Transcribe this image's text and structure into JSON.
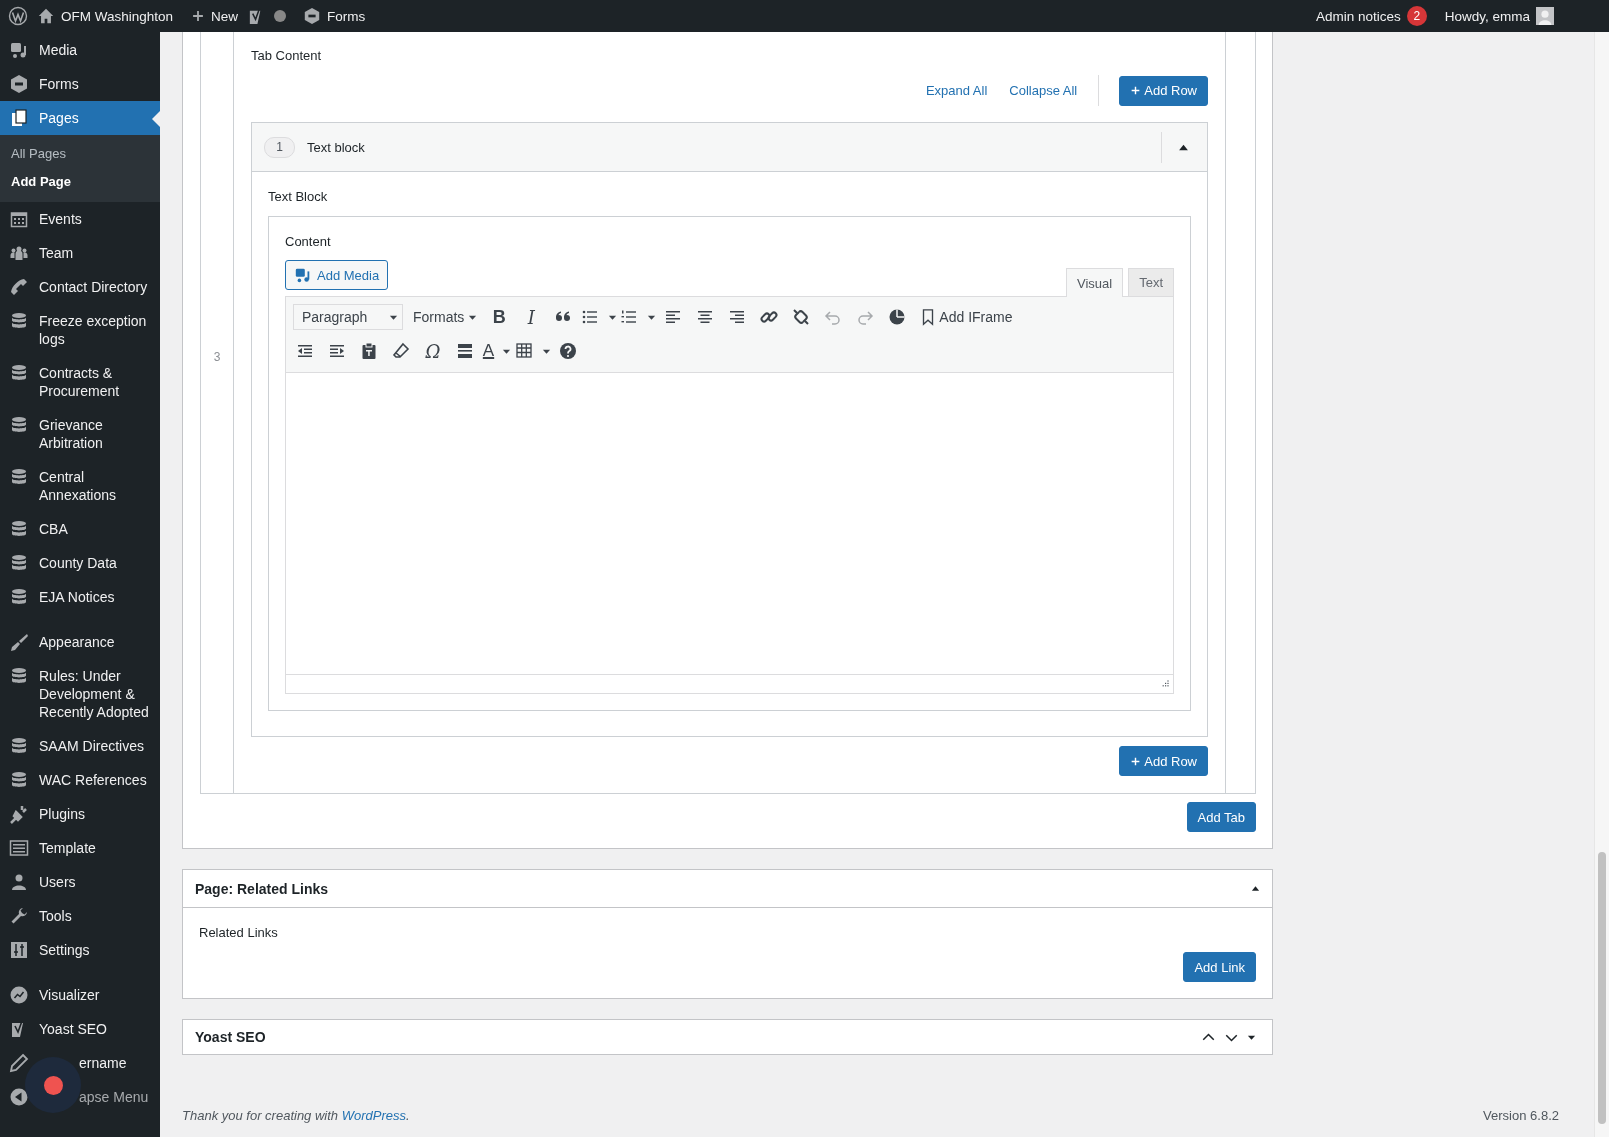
{
  "admin_bar": {
    "site_name": "OFM Washinghton",
    "new_label": "New",
    "forms_label": "Forms",
    "notices_label": "Admin notices",
    "notices_count": "2",
    "greeting": "Howdy, emma"
  },
  "sidebar": {
    "groups": [
      {
        "items": [
          {
            "label": "Media",
            "selected": false
          },
          {
            "label": "Forms",
            "selected": false
          },
          {
            "label": "Pages",
            "selected": true,
            "children": [
              {
                "label": "All Pages",
                "selected": false
              },
              {
                "label": "Add Page",
                "selected": true
              }
            ]
          },
          {
            "label": "Events",
            "selected": false
          },
          {
            "label": "Team",
            "selected": false
          },
          {
            "label": "Contact Directory",
            "selected": false
          },
          {
            "label": "Freeze exception logs",
            "selected": false
          },
          {
            "label": "Contracts & Procurement",
            "selected": false
          },
          {
            "label": "Grievance Arbitration",
            "selected": false
          },
          {
            "label": "Central Annexations",
            "selected": false
          },
          {
            "label": "CBA",
            "selected": false
          },
          {
            "label": "County Data",
            "selected": false
          },
          {
            "label": "EJA Notices",
            "selected": false
          }
        ]
      },
      {
        "items": [
          {
            "label": "Appearance",
            "selected": false
          },
          {
            "label": "Rules: Under Development & Recently Adopted",
            "selected": false
          },
          {
            "label": "SAAM Directives",
            "selected": false
          },
          {
            "label": "WAC References",
            "selected": false
          },
          {
            "label": "Plugins",
            "selected": false
          },
          {
            "label": "Template",
            "selected": false
          },
          {
            "label": "Users",
            "selected": false
          },
          {
            "label": "Tools",
            "selected": false
          },
          {
            "label": "Settings",
            "selected": false
          }
        ]
      },
      {
        "items": [
          {
            "label": "Visualizer",
            "selected": false
          },
          {
            "label": "Yoast SEO",
            "selected": false
          },
          {
            "label": "ername",
            "selected": false,
            "covered": true
          },
          {
            "label": "apse Menu",
            "selected": false,
            "covered": true,
            "dimmed": true
          }
        ]
      }
    ]
  },
  "tabs_field": {
    "row_number": "3",
    "label": "Tab Content",
    "expand_all": "Expand All",
    "collapse_all": "Collapse All",
    "add_row_top": "Add Row",
    "add_row_bottom": "Add Row",
    "add_tab": "Add Tab",
    "layout": {
      "index": "1",
      "title": "Text block",
      "expanded": true,
      "field_label": "Text Block",
      "editor": {
        "label": "Content",
        "add_media": "Add Media",
        "tabs": [
          {
            "label": "Visual",
            "selected": true
          },
          {
            "label": "Text",
            "selected": false
          }
        ],
        "toolbar_rows": [
          [
            {
              "kind": "select",
              "label": "Paragraph"
            },
            {
              "kind": "menu",
              "label": "Formats"
            },
            {
              "kind": "glyph",
              "text": "B",
              "bold": true,
              "disabled": false
            },
            {
              "kind": "glyph",
              "text": "I",
              "bold": false,
              "disabled": false
            },
            {
              "kind": "icon",
              "disabled": false
            },
            {
              "kind": "split",
              "disabled": false
            },
            {
              "kind": "split",
              "disabled": false
            },
            {
              "kind": "icon",
              "disabled": false
            },
            {
              "kind": "icon",
              "disabled": false
            },
            {
              "kind": "icon",
              "disabled": false
            },
            {
              "kind": "icon",
              "disabled": false
            },
            {
              "kind": "icon",
              "disabled": false
            },
            {
              "kind": "icon",
              "disabled": true
            },
            {
              "kind": "icon",
              "disabled": true
            },
            {
              "kind": "icon",
              "disabled": false
            },
            {
              "kind": "text-button",
              "label": "Add IFrame"
            }
          ],
          [
            {
              "kind": "icon",
              "disabled": false
            },
            {
              "kind": "icon",
              "disabled": false
            },
            {
              "kind": "icon",
              "disabled": false
            },
            {
              "kind": "icon",
              "disabled": false
            },
            {
              "kind": "glyph",
              "text": "Ω",
              "bold": false,
              "disabled": false
            },
            {
              "kind": "icon",
              "disabled": false
            },
            {
              "kind": "split",
              "text": "A",
              "disabled": false
            },
            {
              "kind": "split",
              "disabled": false
            },
            {
              "kind": "icon",
              "disabled": false
            }
          ]
        ]
      }
    }
  },
  "related_links": {
    "title": "Page: Related Links",
    "label": "Related Links",
    "add_link": "Add Link"
  },
  "yoast": {
    "title": "Yoast SEO"
  },
  "footer": {
    "text": "Thank you for creating with ",
    "link": "WordPress",
    "after": ".",
    "version": "Version 6.8.2"
  }
}
